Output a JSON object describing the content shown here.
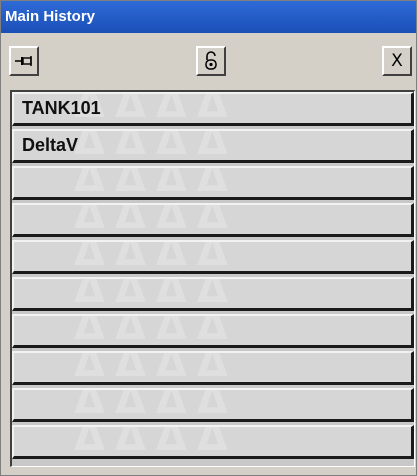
{
  "window": {
    "title": "Main History"
  },
  "toolbar": {
    "pin_icon": "pin-icon",
    "lock_icon": "padlock-icon",
    "close_glyph": "X"
  },
  "rows": [
    "TANK101",
    "DeltaV",
    "",
    "",
    "",
    "",
    "",
    "",
    "",
    ""
  ],
  "colors": {
    "titlebar": "#2f6bd8",
    "panel": "#d4d0c8",
    "row": "#d6d6d6"
  }
}
